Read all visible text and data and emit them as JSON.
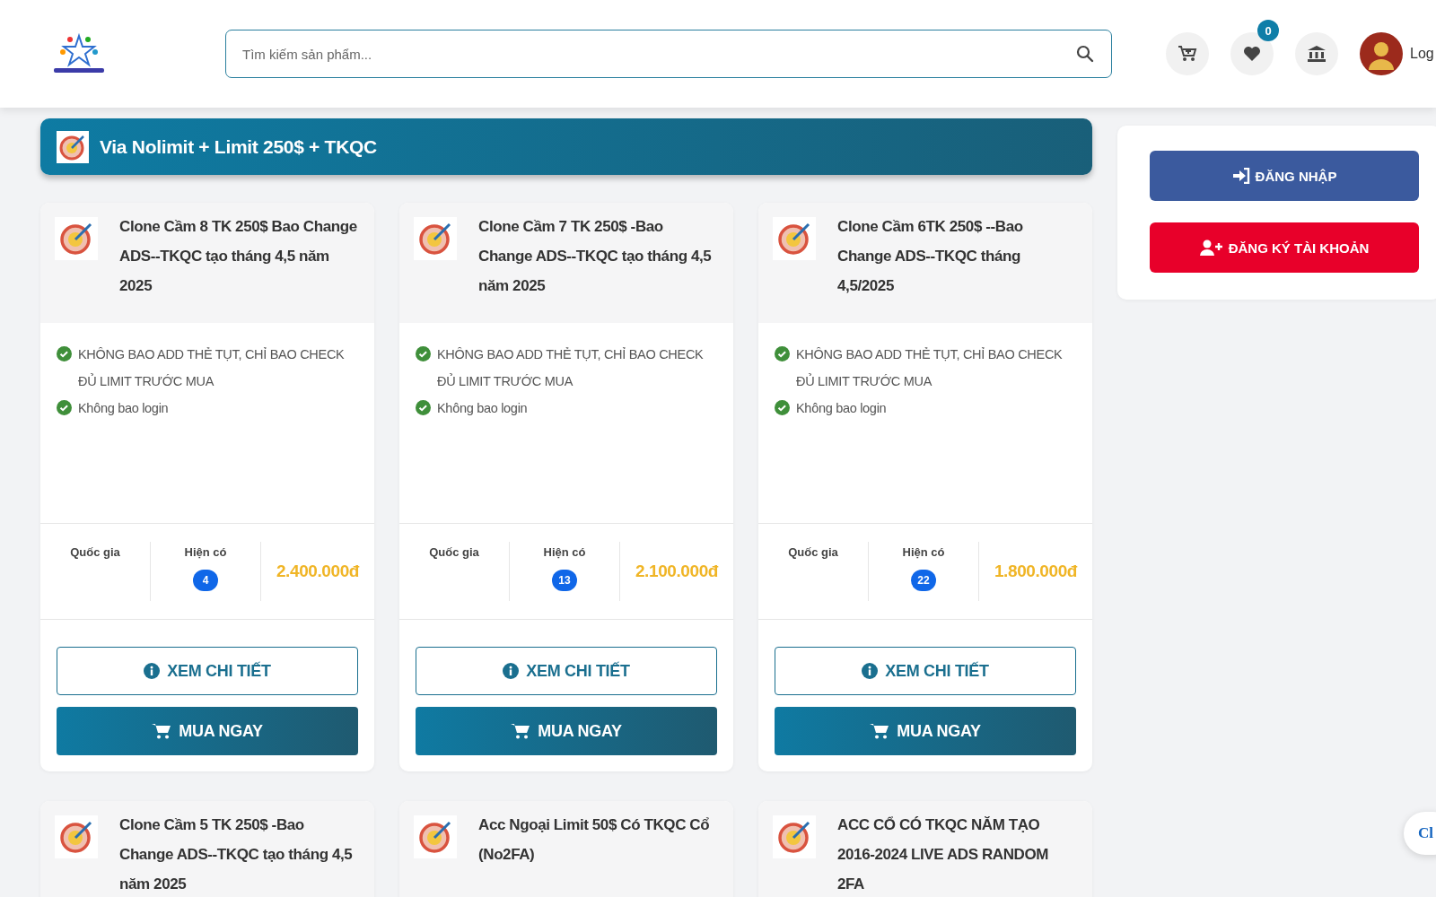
{
  "header": {
    "search": {
      "placeholder": "Tìm kiếm sản phẩm..."
    },
    "wishlist_count": "0",
    "login_text": "Log"
  },
  "category": {
    "title": "Via Nolimit + Limit 250$ + TKQC"
  },
  "products": [
    {
      "title": "Clone Cầm 8 TK 250$ Bao Change ADS--TKQC tạo tháng 4,5 năm 2025",
      "features": [
        {
          "text": "KHÔNG BAO ADD THẺ TỤT, CHỈ BAO CHECK ĐỦ LIMIT TRƯỚC MUA"
        },
        {
          "text": "Không bao login"
        }
      ],
      "country_label": "Quốc gia",
      "stock_label": "Hiện có",
      "stock": "4",
      "price": "2.400.000đ",
      "detail_button": "XEM CHI TIẾT",
      "buy_button": "MUA NGAY"
    },
    {
      "title": "Clone Cầm 7 TK 250$ -Bao Change ADS--TKQC tạo tháng 4,5 năm 2025",
      "features": [
        {
          "text": "KHÔNG BAO ADD THẺ TỤT, CHỈ BAO CHECK ĐỦ LIMIT TRƯỚC MUA"
        },
        {
          "text": "Không bao login"
        }
      ],
      "country_label": "Quốc gia",
      "stock_label": "Hiện có",
      "stock": "13",
      "price": "2.100.000đ",
      "detail_button": "XEM CHI TIẾT",
      "buy_button": "MUA NGAY"
    },
    {
      "title": "Clone Cầm 6TK 250$ --Bao Change ADS--TKQC tháng 4,5/2025",
      "features": [
        {
          "text": "KHÔNG BAO ADD THẺ TỤT, CHỈ BAO CHECK ĐỦ LIMIT TRƯỚC MUA"
        },
        {
          "text": "Không bao login"
        }
      ],
      "country_label": "Quốc gia",
      "stock_label": "Hiện có",
      "stock": "22",
      "price": "1.800.000đ",
      "detail_button": "XEM CHI TIẾT",
      "buy_button": "MUA NGAY"
    },
    {
      "title": "Clone Cầm 5 TK 250$ -Bao Change ADS--TKQC tạo tháng 4,5 năm 2025"
    },
    {
      "title": "Acc Ngoại Limit 50$ Có TKQC Cổ (No2FA)"
    },
    {
      "title": "ACC CỔ CÓ TKQC NĂM TẠO 2016-2024 LIVE ADS RANDOM 2FA"
    }
  ],
  "sidebar": {
    "login_button": "ĐĂNG NHẬP",
    "register_button": "ĐĂNG KÝ TÀI KHOẢN"
  },
  "chat_label": "Cl"
}
